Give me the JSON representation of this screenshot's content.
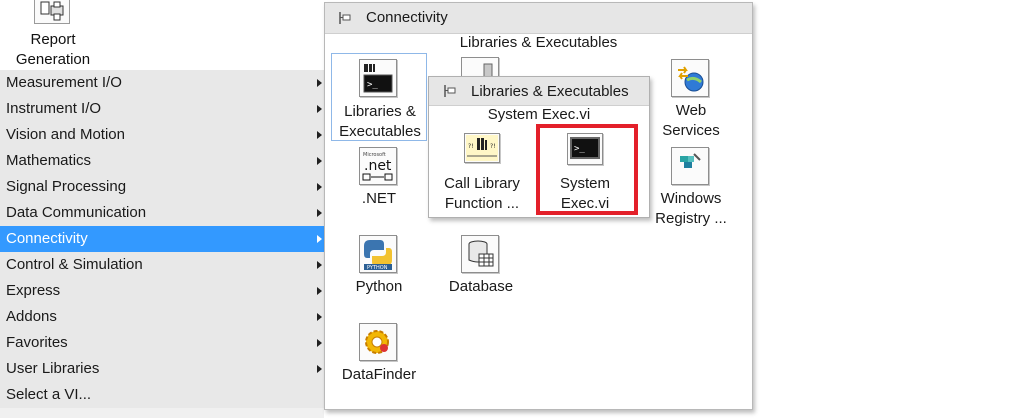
{
  "top_tile": {
    "label": "Report\nGeneration",
    "line1": "Report",
    "line2": "Generation"
  },
  "menu": {
    "items": [
      {
        "label": "Measurement I/O",
        "submenu": true
      },
      {
        "label": "Instrument I/O",
        "submenu": true
      },
      {
        "label": "Vision and Motion",
        "submenu": true
      },
      {
        "label": "Mathematics",
        "submenu": true
      },
      {
        "label": "Signal Processing",
        "submenu": true
      },
      {
        "label": "Data Communication",
        "submenu": true
      },
      {
        "label": "Connectivity",
        "submenu": true,
        "selected": true
      },
      {
        "label": "Control & Simulation",
        "submenu": true
      },
      {
        "label": "Express",
        "submenu": true
      },
      {
        "label": "Addons",
        "submenu": true
      },
      {
        "label": "Favorites",
        "submenu": true
      },
      {
        "label": "User Libraries",
        "submenu": true
      },
      {
        "label": "Select a VI...",
        "submenu": false
      }
    ]
  },
  "connectivity": {
    "title": "Connectivity",
    "section_label": "Libraries & Executables",
    "items": [
      {
        "line1": "Libraries &",
        "line2": "Executables",
        "icon": "libraries-executables-icon"
      },
      {
        "line1": "Web",
        "line2": "Services",
        "icon": "web-services-icon"
      },
      {
        "line1": ".NET",
        "line2": "",
        "icon": "dotnet-icon"
      },
      {
        "line1": "Windows",
        "line2": "Registry ...",
        "icon": "windows-registry-icon"
      },
      {
        "line1": "Python",
        "line2": "",
        "icon": "python-icon"
      },
      {
        "line1": "Database",
        "line2": "",
        "icon": "database-icon"
      },
      {
        "line1": "DataFinder",
        "line2": "",
        "icon": "datafinder-icon"
      }
    ]
  },
  "sub_palette": {
    "title": "Libraries & Executables",
    "section_label": "System Exec.vi",
    "items": [
      {
        "line1": "Call Library",
        "line2": "Function ...",
        "icon": "call-library-function-icon"
      },
      {
        "line1": "System",
        "line2": "Exec.vi",
        "icon": "system-exec-icon"
      }
    ],
    "highlight_color": "#e3202a"
  },
  "colors": {
    "selection": "#3399ff",
    "panel_bg": "#f0f0f0",
    "header_bg": "#e6e6e6"
  }
}
